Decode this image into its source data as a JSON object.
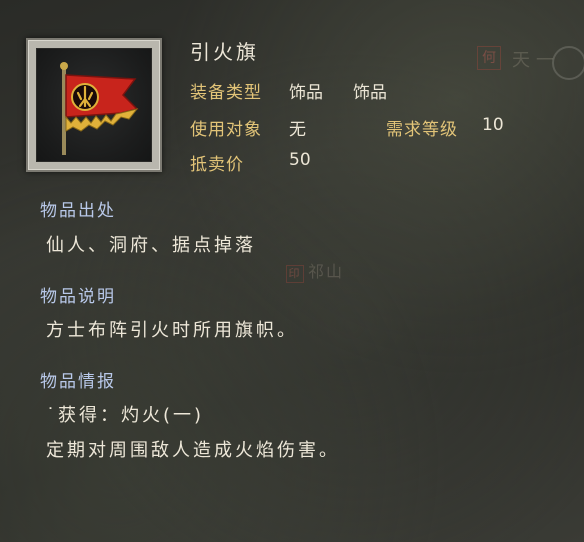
{
  "background": {
    "map_seal": "何",
    "map_text_top": "天一",
    "map_seal_2": "印",
    "map_text_mid": "祁山"
  },
  "item": {
    "name": "引火旗",
    "icon": "red-flag-with-fire-emblem",
    "attributes": {
      "equip_type": {
        "label": "装备类型",
        "value_1": "饰品",
        "value_2": "饰品"
      },
      "target": {
        "label": "使用对象",
        "value": "无"
      },
      "level_req": {
        "label": "需求等级",
        "value": "10"
      },
      "sell_price": {
        "label": "抵卖价",
        "value": "50"
      }
    }
  },
  "sections": {
    "origin": {
      "title": "物品出处",
      "text": "仙人、洞府、据点掉落"
    },
    "description": {
      "title": "物品说明",
      "text": "方士布阵引火时所用旗帜。"
    },
    "info": {
      "title": "物品情报",
      "line_1": "˙获得：灼火(一)",
      "line_2": "定期对周围敌人造成火焰伤害。"
    }
  },
  "colors": {
    "label_gold": "#e2c478",
    "heading_blue": "#b9c9ea",
    "text_white": "#ede7d8",
    "flag_red": "#c8241c",
    "flag_gold": "#e0b13a"
  }
}
